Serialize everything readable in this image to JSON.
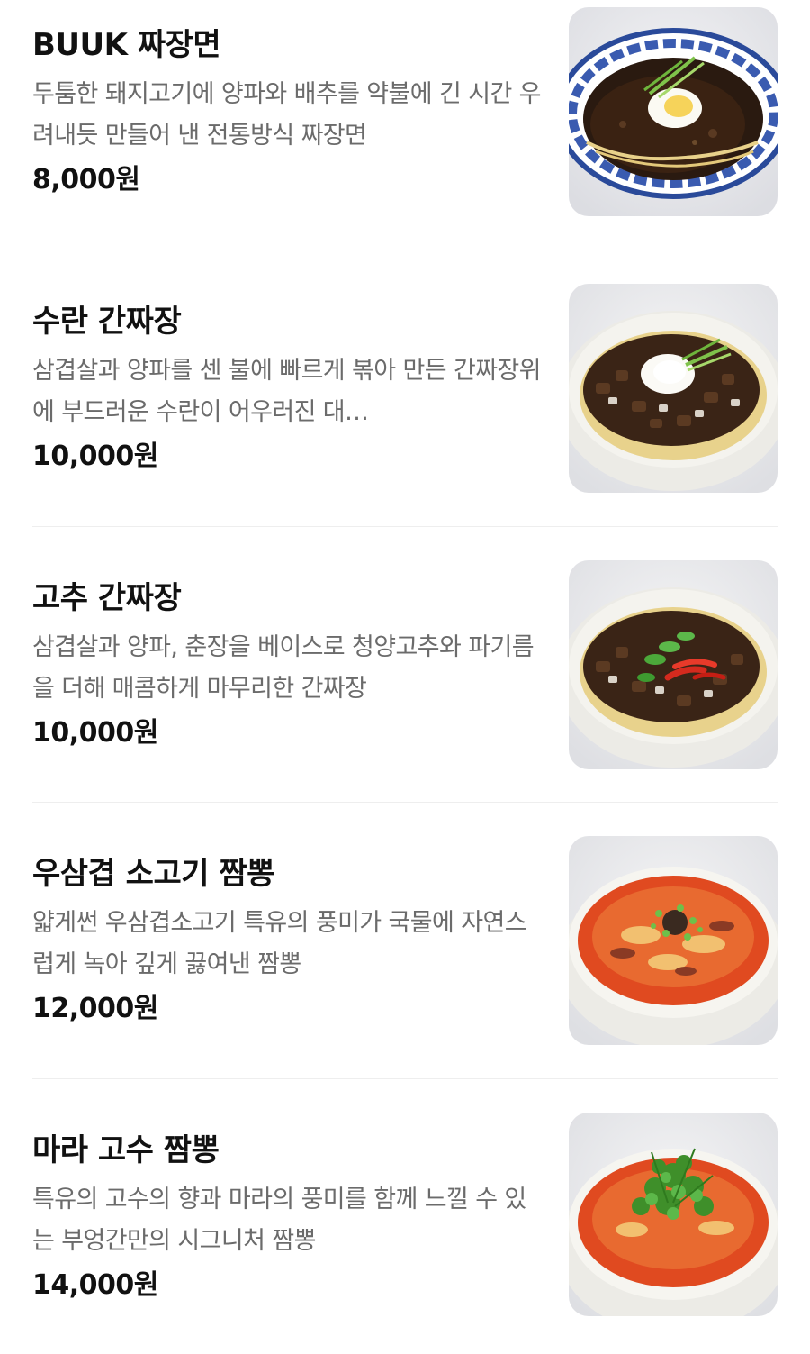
{
  "menu": {
    "items": [
      {
        "name": "BUUK 짜장면",
        "description": "두툼한 돼지고기에 양파와 배추를 약불에 긴 시간 우려내듯 만들어 낸 전통방식 짜장면",
        "price": "8,000원",
        "image": "jjajangmyeon-photo"
      },
      {
        "name": "수란 간짜장",
        "description": "삼겹살과 양파를 센 불에 빠르게 볶아 만든 간짜장위에 부드러운 수란이 어우러진 대…",
        "price": "10,000원",
        "image": "ganjjajang-poached-egg-photo"
      },
      {
        "name": "고추 간짜장",
        "description": "삼겹살과 양파, 춘장을 베이스로 청양고추와 파기름을 더해 매콤하게 마무리한 간짜장",
        "price": "10,000원",
        "image": "ganjjajang-chili-photo"
      },
      {
        "name": "우삼겹 소고기 짬뽕",
        "description": "얇게썬 우삼겹소고기 특유의 풍미가 국물에 자연스럽게 녹아 깊게 끓여낸 짬뽕",
        "price": "12,000원",
        "image": "beef-jjamppong-photo"
      },
      {
        "name": "마라 고수 짬뽕",
        "description": "특유의 고수의 향과 마라의 풍미를 함께 느낄 수 있는 부엉간만의 시그니처 짬뽕",
        "price": "14,000원",
        "image": "mala-coriander-jjamppong-photo"
      }
    ]
  },
  "colors": {
    "text_primary": "#111111",
    "text_secondary": "#6b6b6b",
    "divider": "#eeeeee",
    "background": "#ffffff"
  }
}
